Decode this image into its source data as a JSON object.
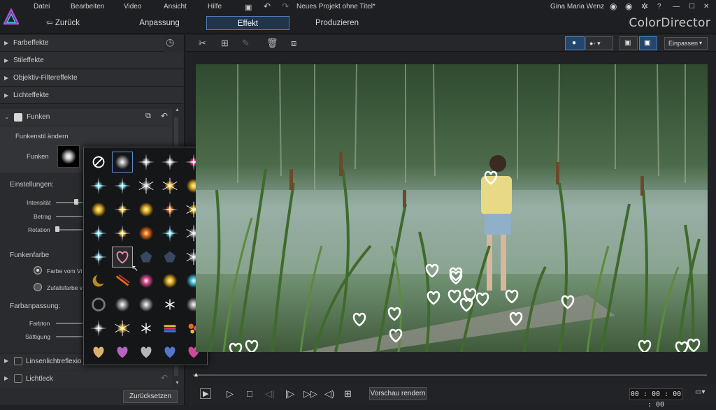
{
  "menu": [
    "Datei",
    "Bearbeiten",
    "Video",
    "Ansicht",
    "Hilfe"
  ],
  "project_title": "Neues Projekt ohne Titel*",
  "user_name": "Gina Maria Wenz",
  "nav": {
    "back": "Zurück",
    "tabs": [
      "Anpassung",
      "Effekt",
      "Produzieren"
    ],
    "active_tab": "Effekt"
  },
  "app_name": "ColorDirector",
  "categories": [
    "Farbeffekte",
    "Stileffekte",
    "Objektiv-Filtereffekte",
    "Lichteffekte"
  ],
  "funken": {
    "label": "Funken",
    "style_heading": "Funkenstil ändern",
    "style_label": "Funken",
    "settings_heading": "Einstellungen:",
    "sliders": [
      "Intensität",
      "Betrag",
      "Rotation"
    ],
    "color_heading": "Funkenfarbe",
    "color_options": [
      "Farbe vom Vi",
      "Zufallsfarbe v"
    ],
    "color_adjust_heading": "Farbanpassung:",
    "color_adjust_sliders": [
      "Farbton",
      "Sättigung"
    ]
  },
  "bottom_effects": [
    "Linsenlichtreflexio",
    "Lichtleck"
  ],
  "reset_label": "Zurücksetzen",
  "toolbar": {
    "fit_label": "Einpassen"
  },
  "controls": {
    "render_label": "Vorschau rendern",
    "timecode": "00 : 00 : 00 : 00"
  },
  "colors": {
    "accent": "#4b7fb8",
    "panel": "#2a2b2e",
    "bg": "#202124"
  }
}
